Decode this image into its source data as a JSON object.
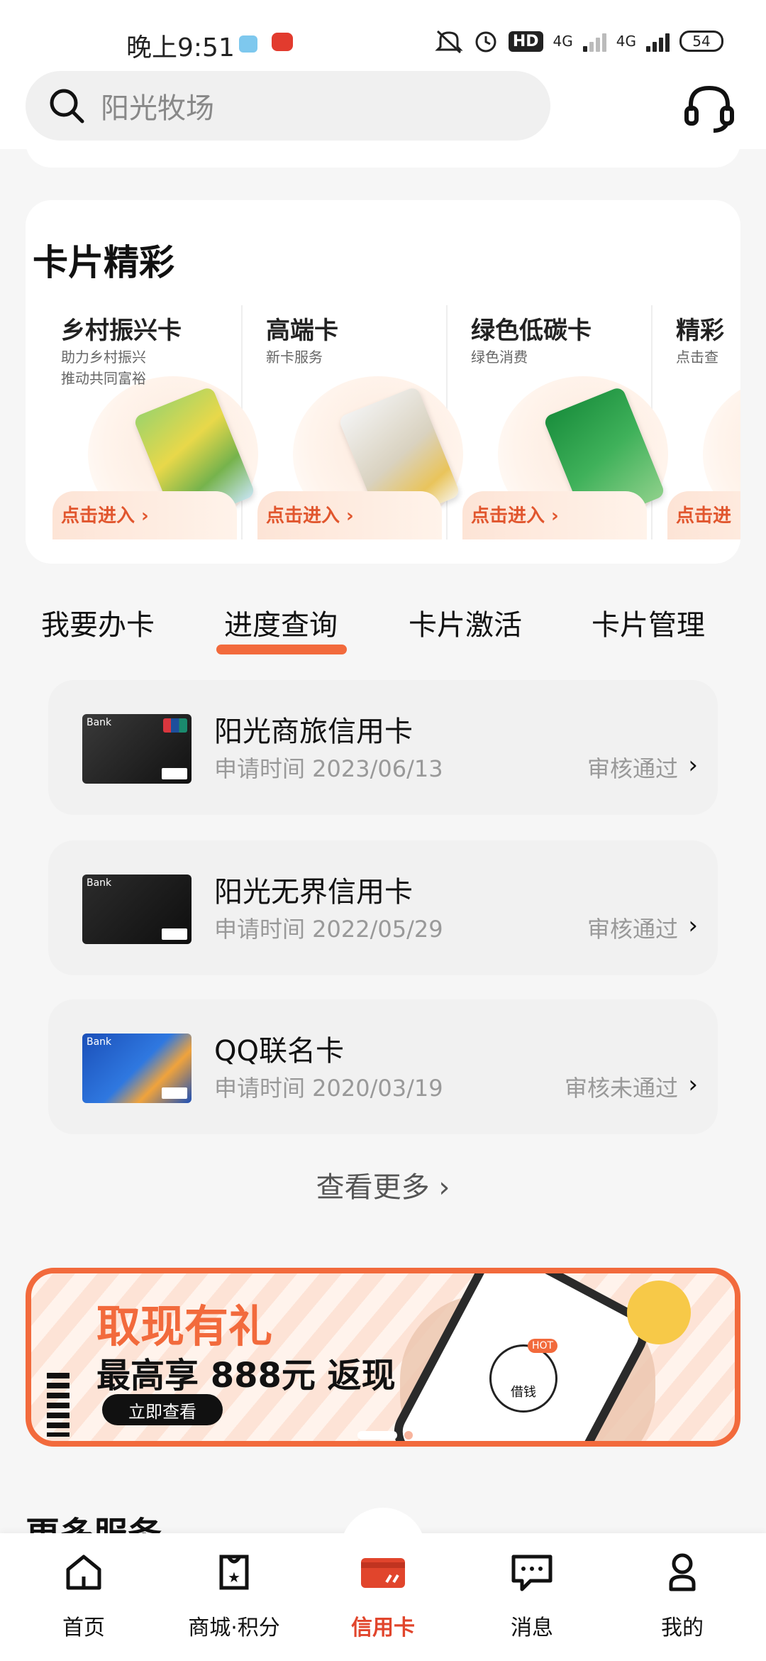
{
  "status_bar": {
    "time": "晚上9:51",
    "hd_label": "HD",
    "net_1": "4G",
    "net_2": "4G",
    "battery": "54"
  },
  "search": {
    "placeholder": "阳光牧场"
  },
  "cards_section": {
    "title": "卡片精彩",
    "items": [
      {
        "title": "乡村振兴卡",
        "subtitle": "助力乡村振兴\n推动共同富裕",
        "cta": "点击进入 ›"
      },
      {
        "title": "高端卡",
        "subtitle": "新卡服务",
        "cta": "点击进入 ›"
      },
      {
        "title": "绿色低碳卡",
        "subtitle": "绿色消费",
        "cta": "点击进入 ›"
      },
      {
        "title": "精彩",
        "subtitle": "点击查",
        "cta": "点击进"
      }
    ]
  },
  "tabs": [
    {
      "label": "我要办卡"
    },
    {
      "label": "进度查询"
    },
    {
      "label": "卡片激活"
    },
    {
      "label": "卡片管理"
    }
  ],
  "progress": {
    "items": [
      {
        "name": "阳光商旅信用卡",
        "date": "申请时间 2023/06/13",
        "status": "审核通过"
      },
      {
        "name": "阳光无界信用卡",
        "date": "申请时间 2022/05/29",
        "status": "审核通过"
      },
      {
        "name": "QQ联名卡",
        "date": "申请时间 2020/03/19",
        "status": "审核未通过"
      }
    ],
    "view_more": "查看更多 ›"
  },
  "banner": {
    "line1": "取现有礼",
    "line2": "最高享 888元 返现",
    "button": "立即查看",
    "hot": "HOT",
    "loan": "借钱"
  },
  "more_services": "更多服务",
  "bottom_nav": [
    {
      "label": "首页",
      "icon": "home-icon"
    },
    {
      "label": "商城·积分",
      "icon": "mall-icon"
    },
    {
      "label": "信用卡",
      "icon": "credit-card-icon"
    },
    {
      "label": "消息",
      "icon": "message-icon"
    },
    {
      "label": "我的",
      "icon": "profile-icon"
    }
  ],
  "colors": {
    "accent": "#f26a3c",
    "active_nav": "#e1452c"
  }
}
